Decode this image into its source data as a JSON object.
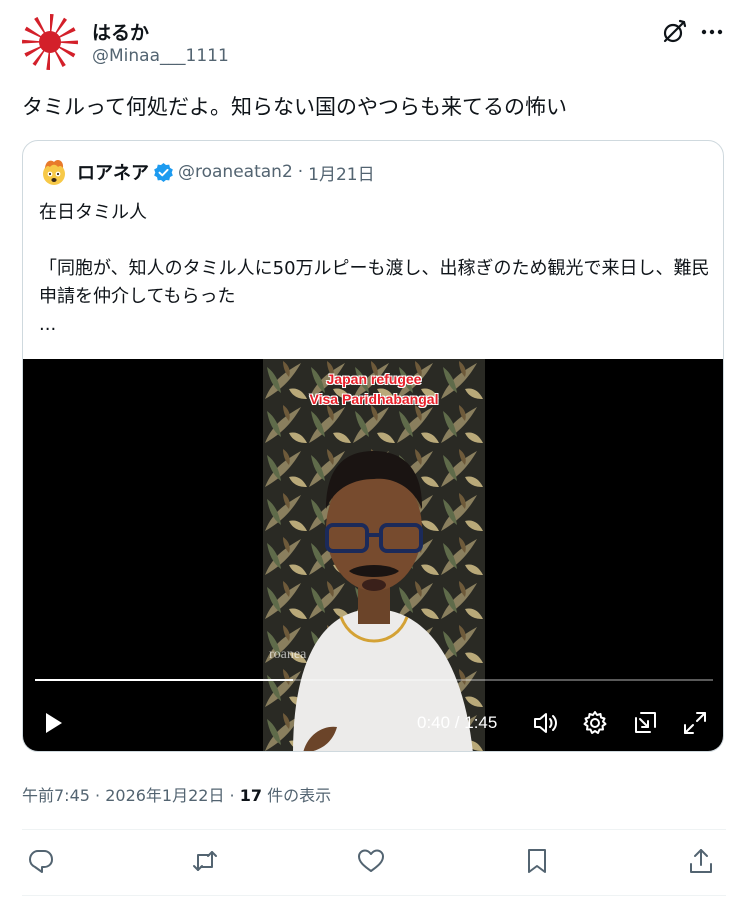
{
  "author": {
    "name": "はるか",
    "handle": "@Minaa___1111"
  },
  "tweet": {
    "text": "タミルって何処だよ。知らない国のやつらも来てるの怖い"
  },
  "quote": {
    "name": "ロアネア",
    "handle": "@roaneatan2",
    "separator": "·",
    "date": "1月21日",
    "text": "在日タミル人\n\n「同胞が、知人のタミル人に50万ルピーも渡し、出稼ぎのため観光で来日し、難民申請を仲介してもらった\n..."
  },
  "video": {
    "caption_line1": "Japan refugee",
    "caption_line2": "Visa Paridhabangal",
    "watermark": "roanea",
    "time": "0:40 / 1:45",
    "progress": 0.381
  },
  "meta": {
    "time": "午前7:45",
    "sep1": " · ",
    "date": "2026年1月22日",
    "sep2": " · ",
    "views_count": "17",
    "views_label": " 件の表示"
  },
  "icons": {
    "grok": "grok-icon",
    "more": "more-icon",
    "verified": "verified-badge-icon",
    "play": "play-icon",
    "volume": "volume-icon",
    "settings": "settings-icon",
    "dock": "dock-icon",
    "fullscreen": "fullscreen-icon",
    "reply": "reply-icon",
    "retweet": "retweet-icon",
    "like": "like-icon",
    "bookmark": "bookmark-icon",
    "share": "share-icon"
  },
  "colors": {
    "text": "#0f1419",
    "secondary": "#536471",
    "verified": "#1d9bf0",
    "border": "#cfd9de",
    "caption": "#e8202a"
  }
}
